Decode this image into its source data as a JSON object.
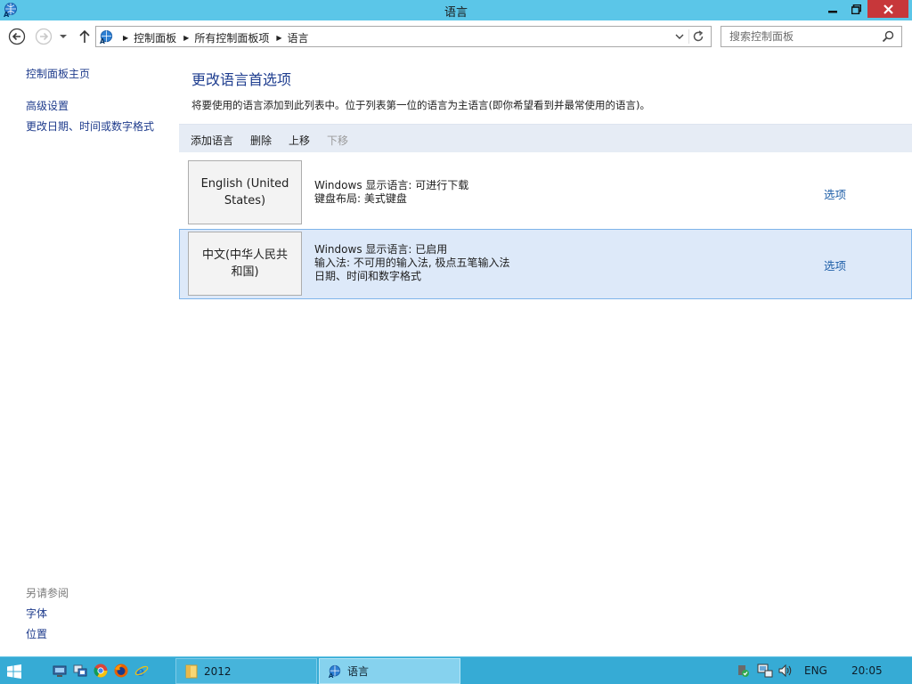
{
  "window": {
    "title": "语言",
    "controls": {
      "minimize": "minimize",
      "restore": "restore",
      "close": "close"
    }
  },
  "nav": {
    "breadcrumb": [
      "控制面板",
      "所有控制面板项",
      "语言"
    ],
    "search_placeholder": "搜索控制面板"
  },
  "sidebar": {
    "home": "控制面板主页",
    "links": [
      "高级设置",
      "更改日期、时间或数字格式"
    ],
    "see_also_heading": "另请参阅",
    "see_also": [
      "字体",
      "位置"
    ]
  },
  "main": {
    "title": "更改语言首选项",
    "description": "将要使用的语言添加到此列表中。位于列表第一位的语言为主语言(即你希望看到并最常使用的语言)。",
    "toolbar": {
      "add": "添加语言",
      "remove": "删除",
      "move_up": "上移",
      "move_down": "下移"
    },
    "languages": [
      {
        "name": "English (United States)",
        "line1": "Windows 显示语言: 可进行下载",
        "line2": "键盘布局: 美式键盘",
        "line3": "",
        "options": "选项",
        "selected": false
      },
      {
        "name": "中文(中华人民共和国)",
        "line1": "Windows 显示语言: 已启用",
        "line2": "输入法: 不可用的输入法, 极点五笔输入法",
        "line3": "日期、时间和数字格式",
        "options": "选项",
        "selected": true
      }
    ]
  },
  "taskbar": {
    "tasks": [
      "2012",
      "语言"
    ],
    "lang_indicator": "ENG",
    "clock": "20:05"
  },
  "colors": {
    "titlebar": "#5bc6e8",
    "close": "#c7373a",
    "link": "#1e3b8c",
    "accent_link": "#1f5fa8",
    "selected_row": "#dde9f9",
    "taskbar": "#36abd5"
  }
}
